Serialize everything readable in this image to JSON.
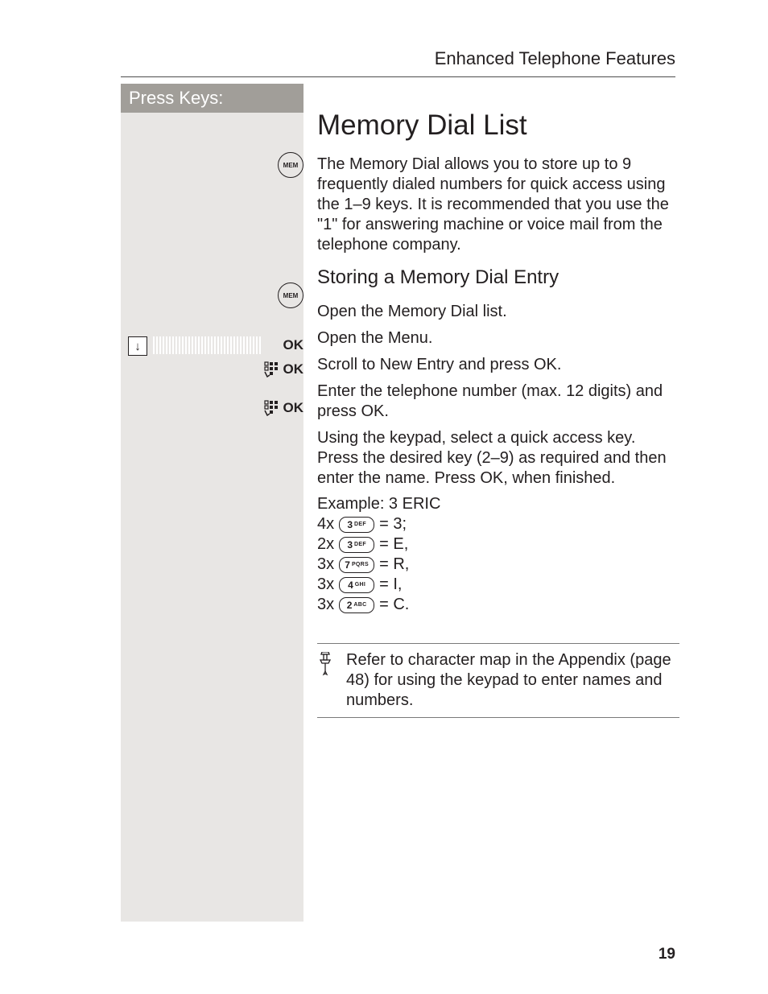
{
  "header": {
    "running_head": "Enhanced Telephone Features"
  },
  "left": {
    "title": "Press Keys:",
    "mem": "MEM",
    "ok": "OK",
    "down_arrow": "↓"
  },
  "main": {
    "title": "Memory Dial List",
    "intro": "The Memory Dial allows you to store up to 9 frequently dialed numbers for quick access using the 1–9 keys. It is recommended that you use the \"1\" for answering machine or voice mail from the telephone company.",
    "sub": "Storing a Memory Dial Entry",
    "steps": {
      "s1": "Open the Memory Dial list.",
      "s2": "Open the Menu.",
      "s3": "Scroll to New Entry and press OK.",
      "s4": "Enter the telephone number (max. 12 digits) and press OK.",
      "s5": "Using the keypad, select a quick access key. Press the desired key (2–9) as required and then enter the name. Press OK, when finished."
    },
    "example": {
      "head": "Example: 3 ERIC",
      "rows": [
        {
          "times": "4x",
          "digit": "3",
          "letters": "DEF",
          "eq": " = 3;"
        },
        {
          "times": "2x",
          "digit": "3",
          "letters": "DEF",
          "eq": " = E,"
        },
        {
          "times": "3x",
          "digit": "7",
          "letters": "PQRS",
          "eq": " = R,"
        },
        {
          "times": "3x",
          "digit": "4",
          "letters": "GHI",
          "eq": " = I,"
        },
        {
          "times": "3x",
          "digit": "2",
          "letters": "ABC",
          "eq": " = C."
        }
      ]
    },
    "note": "Refer to character map in the Appendix (page 48) for using the keypad to enter names and numbers."
  },
  "page_number": "19"
}
